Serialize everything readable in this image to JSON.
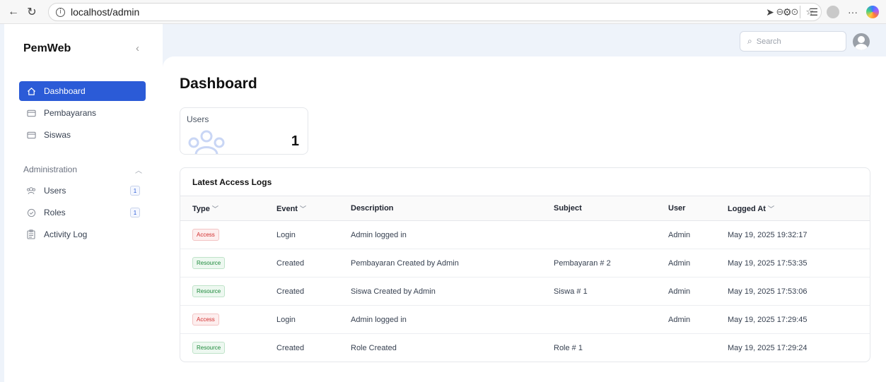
{
  "browser": {
    "url": "localhost/admin"
  },
  "app": {
    "brand": "PemWeb",
    "search_placeholder": "Search"
  },
  "sidebar": {
    "items": [
      {
        "label": "Dashboard",
        "icon": "home-icon"
      },
      {
        "label": "Pembayarans",
        "icon": "folder-icon"
      },
      {
        "label": "Siswas",
        "icon": "folder-icon"
      }
    ],
    "group": {
      "title": "Administration",
      "items": [
        {
          "label": "Users",
          "icon": "users-icon",
          "badge": "1"
        },
        {
          "label": "Roles",
          "icon": "shield-check-icon",
          "badge": "1"
        },
        {
          "label": "Activity Log",
          "icon": "clipboard-icon"
        }
      ]
    }
  },
  "page": {
    "title": "Dashboard"
  },
  "stats": {
    "users": {
      "label": "Users",
      "value": "1"
    }
  },
  "logs": {
    "title": "Latest Access Logs",
    "columns": [
      "Type",
      "Event",
      "Description",
      "Subject",
      "User",
      "Logged At"
    ],
    "rows": [
      {
        "type": "Access",
        "event": "Login",
        "description": "Admin logged in",
        "subject": "",
        "user": "Admin",
        "logged_at": "May 19, 2025 19:32:17"
      },
      {
        "type": "Resource",
        "event": "Created",
        "description": "Pembayaran Created by Admin",
        "subject": "Pembayaran # 2",
        "user": "Admin",
        "logged_at": "May 19, 2025 17:53:35"
      },
      {
        "type": "Resource",
        "event": "Created",
        "description": "Siswa Created by Admin",
        "subject": "Siswa # 1",
        "user": "Admin",
        "logged_at": "May 19, 2025 17:53:06"
      },
      {
        "type": "Access",
        "event": "Login",
        "description": "Admin logged in",
        "subject": "",
        "user": "Admin",
        "logged_at": "May 19, 2025 17:29:45"
      },
      {
        "type": "Resource",
        "event": "Created",
        "description": "Role Created",
        "subject": "Role # 1",
        "user": "",
        "logged_at": "May 19, 2025 17:29:24"
      }
    ]
  },
  "colors": {
    "primary": "#2b5bd7",
    "access_badge": "#d12c2c",
    "resource_badge": "#1e8a3c"
  }
}
